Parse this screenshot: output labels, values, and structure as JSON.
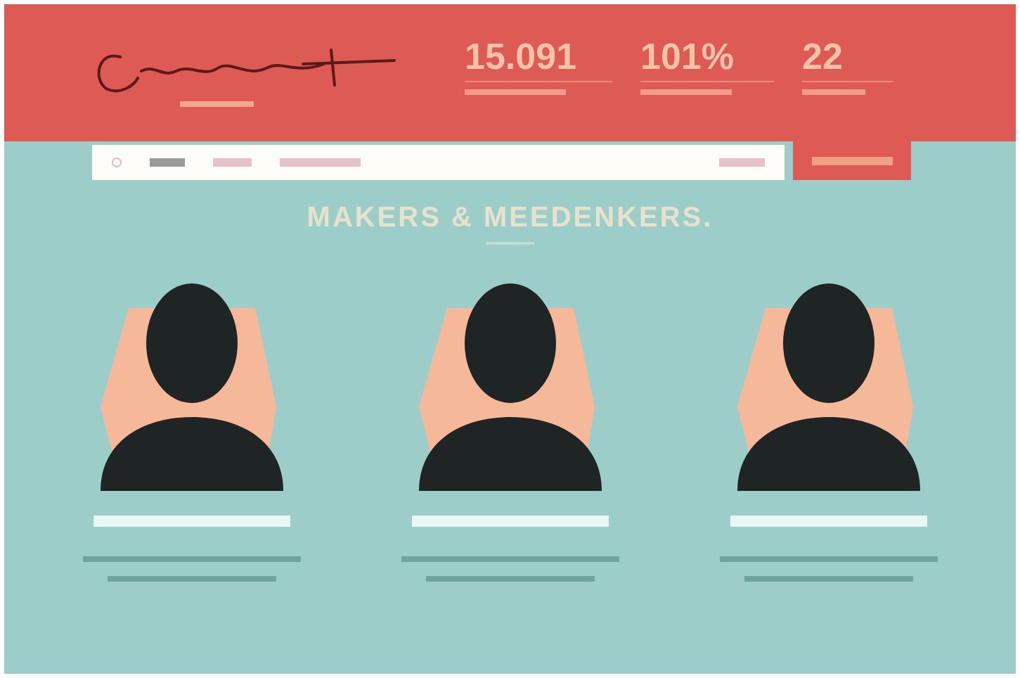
{
  "header": {
    "stats": [
      {
        "value": "15.091"
      },
      {
        "value": "101%"
      },
      {
        "value": "22"
      }
    ]
  },
  "section": {
    "heading": "MAKERS & MEEDENKERS."
  }
}
